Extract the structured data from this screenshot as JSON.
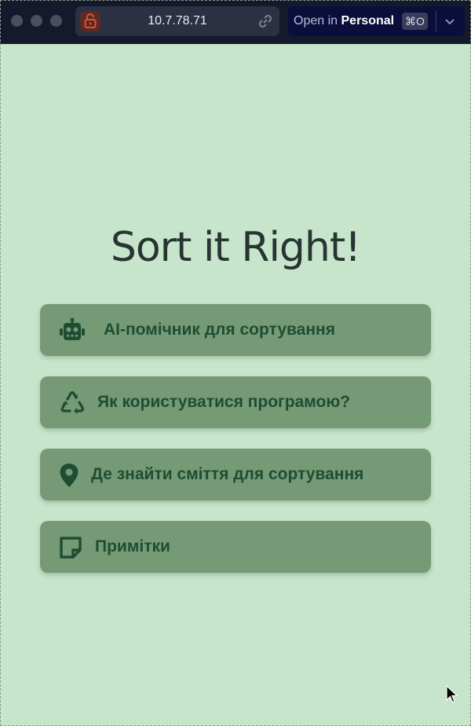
{
  "browser": {
    "url": "10.7.78.71",
    "open_in_prefix": "Open in",
    "open_in_profile": "Personal",
    "open_in_shortcut": "⌘O",
    "lock_icon": "unlocked-padlock-icon",
    "link_icon": "link-icon"
  },
  "app": {
    "title": "Sort it Right!"
  },
  "menu": [
    {
      "label": "AI-помічник для сортування",
      "icon": "robot-icon"
    },
    {
      "label": "Як користуватися програмою?",
      "icon": "recycle-icon"
    },
    {
      "label": "Де знайти сміття для сортування",
      "icon": "location-pin-icon"
    },
    {
      "label": "Примітки",
      "icon": "note-icon"
    }
  ],
  "colors": {
    "background": "#c7e5cb",
    "button": "#769a75",
    "button_text": "#1f4d33",
    "title": "#283433"
  }
}
